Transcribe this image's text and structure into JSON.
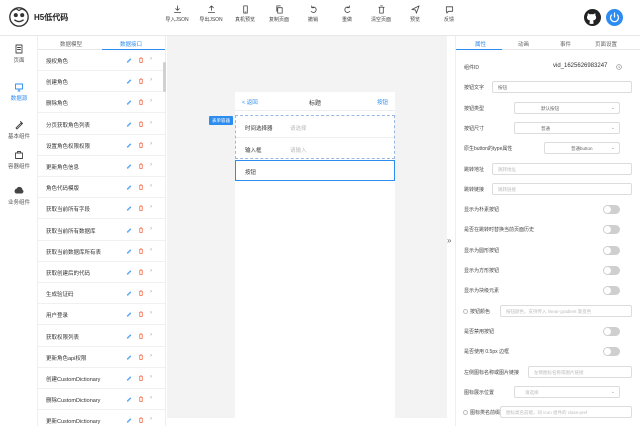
{
  "app": {
    "title": "H5低代码"
  },
  "toolbar": [
    {
      "label": "导入JSON",
      "icon": "import-icon"
    },
    {
      "label": "导出JSON",
      "icon": "export-icon"
    },
    {
      "label": "真机预览",
      "icon": "phone-preview-icon"
    },
    {
      "label": "复制页面",
      "icon": "copy-page-icon"
    },
    {
      "label": "撤销",
      "icon": "undo-icon"
    },
    {
      "label": "重做",
      "icon": "redo-icon"
    },
    {
      "label": "清空页面",
      "icon": "clear-page-icon"
    },
    {
      "label": "预览",
      "icon": "preview-icon"
    },
    {
      "label": "反馈",
      "icon": "feedback-icon"
    }
  ],
  "rail": [
    {
      "label": "页面",
      "icon": "page-icon",
      "active": false
    },
    {
      "label": "数据源",
      "icon": "datasource-icon",
      "active": true
    },
    {
      "label": "基本组件",
      "icon": "basic-component-icon",
      "active": false
    },
    {
      "label": "容器组件",
      "icon": "container-component-icon",
      "active": false
    },
    {
      "label": "业务组件",
      "icon": "business-component-icon",
      "active": false
    }
  ],
  "list_panel": {
    "tabs": [
      "数据模型",
      "数据接口"
    ],
    "active_tab": 1,
    "items": [
      "授权角色",
      "创建角色",
      "删除角色",
      "分页获取角色列表",
      "设置角色权限权限",
      "更新角色信息",
      "角色代码模版",
      "获取当前所有字段",
      "获取当前所有数据库",
      "获取当前数据库所有表",
      "获取创建后的代码",
      "生成验证码",
      "用户登录",
      "获取权限列表",
      "更新角色api权限",
      "创建CustomDictionary",
      "删除CustomDictionary",
      "更新CustomDictionary"
    ]
  },
  "canvas": {
    "phone": {
      "back": "返回",
      "title": "标题",
      "right": "按钮"
    },
    "form_rows": [
      {
        "label": "时间选择器",
        "placeholder": "请选择"
      },
      {
        "label": "输入框",
        "placeholder": "请输入"
      }
    ],
    "button_label": "按钮",
    "form_tag": "表单容器",
    "collapse": "»"
  },
  "props": {
    "tabs": [
      "属性",
      "动画",
      "事件",
      "页面设置"
    ],
    "active_tab": 0,
    "rows": [
      {
        "label": "组件ID",
        "kind": "text",
        "value": "vid_1625626983247"
      },
      {
        "label": "按钮文字",
        "kind": "input",
        "value": "按钮"
      },
      {
        "label": "按钮类型",
        "kind": "select",
        "value": "默认按钮"
      },
      {
        "label": "按钮尺寸",
        "kind": "select",
        "value": "普通"
      },
      {
        "label": "原生button的type属性",
        "kind": "select",
        "value": "普通button"
      },
      {
        "label": "跳转地址",
        "kind": "input",
        "placeholder": "跳转地址"
      },
      {
        "label": "跳转链接",
        "kind": "input",
        "placeholder": "跳转链接"
      },
      {
        "label": "显示为朴素按钮",
        "kind": "toggle"
      },
      {
        "label": "是否在跳转时替换当前页面历史",
        "kind": "toggle"
      },
      {
        "label": "显示为圆形按钮",
        "kind": "toggle"
      },
      {
        "label": "显示为方形按钮",
        "kind": "toggle"
      },
      {
        "label": "显示为块级元素",
        "kind": "toggle"
      },
      {
        "label": "按钮颜色",
        "kind": "radio-input",
        "placeholder": "按钮颜色，支持传入 linear-gradient 渐变色"
      },
      {
        "label": "是否禁用按钮",
        "kind": "toggle"
      },
      {
        "label": "是否使用 0.5px 边框",
        "kind": "toggle"
      },
      {
        "label": "左侧图标名称或图片链接",
        "kind": "input",
        "placeholder": "左侧图标名称或图片链接"
      },
      {
        "label": "图标展示位置",
        "kind": "select",
        "placeholder": "请选择"
      },
      {
        "label": "图标类名前缀",
        "kind": "radio-input",
        "placeholder": "图标类名前缀，同 Icon 组件的 class-pref"
      }
    ]
  },
  "colors": {
    "accent": "#2d8cf0",
    "danger": "#ed4014"
  }
}
